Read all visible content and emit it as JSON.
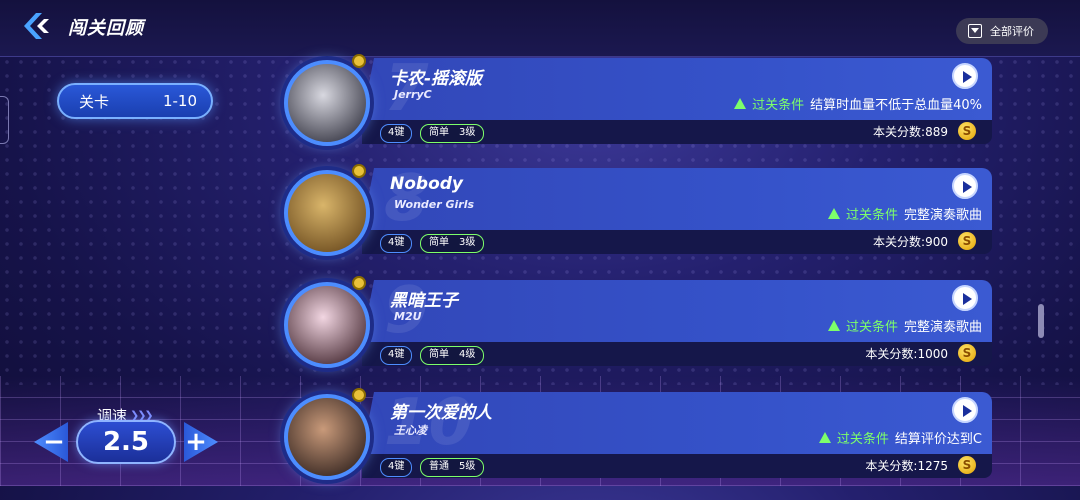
{
  "header": {
    "title": "闯关回顾",
    "rating_button_label": "全部评价"
  },
  "stage": {
    "label": "关卡",
    "range": "1-10"
  },
  "speed": {
    "label": "调速",
    "value": "2.5",
    "minus_label": "−",
    "plus_label": "+"
  },
  "songs": [
    {
      "number": "7",
      "title": "卡农-摇滚版",
      "artist": "JerryC",
      "keys": "4键",
      "difficulty": "简单",
      "level": "3级",
      "condition_label": "过关条件",
      "condition": "结算时血量不低于总血量40%",
      "score": "本关分数:889",
      "cover_colors": [
        "#d8d8e0",
        "#1c1c2a"
      ]
    },
    {
      "number": "8",
      "title": "Nobody",
      "artist": "Wonder Girls",
      "keys": "4键",
      "difficulty": "简单",
      "level": "3级",
      "condition_label": "过关条件",
      "condition": "完整演奏歌曲",
      "score": "本关分数:900",
      "cover_colors": [
        "#d9b56a",
        "#5a3a12"
      ]
    },
    {
      "number": "9",
      "title": "黑暗王子",
      "artist": "M2U",
      "keys": "4键",
      "difficulty": "简单",
      "level": "4级",
      "condition_label": "过关条件",
      "condition": "完整演奏歌曲",
      "score": "本关分数:1000",
      "cover_colors": [
        "#f2d6e2",
        "#2a0e16"
      ]
    },
    {
      "number": "10",
      "title": "第一次爱的人",
      "artist": "王心凌",
      "keys": "4键",
      "difficulty": "普通",
      "level": "5级",
      "condition_label": "过关条件",
      "condition": "结算评价达到C",
      "score": "本关分数:1275",
      "cover_colors": [
        "#c99a7a",
        "#1a1010"
      ]
    }
  ]
}
